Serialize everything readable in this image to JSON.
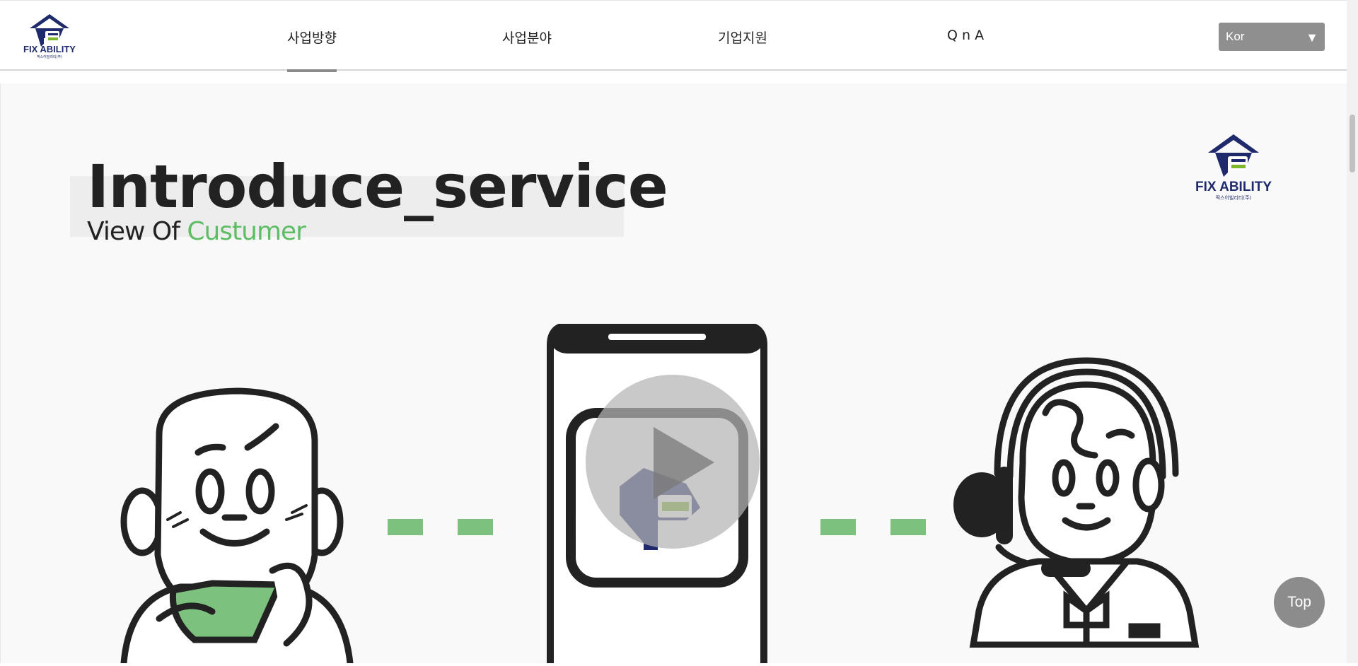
{
  "header": {
    "logo": {
      "text": "FIX ABILITY",
      "subtext": "픽스어빌리티(주)"
    },
    "nav": [
      {
        "label": "사업방향"
      },
      {
        "label": "사업분야"
      },
      {
        "label": "기업지원"
      },
      {
        "label": "Q n A"
      }
    ],
    "language": {
      "selected": "Kor"
    }
  },
  "hero": {
    "title": "Introduce_service",
    "subtitle_prefix": "View Of ",
    "subtitle_accent": "Custumer",
    "logo": {
      "text": "FIX ABILITY",
      "subtext": "픽스어빌리티(주)"
    }
  },
  "video": {
    "play_icon": "play-icon"
  },
  "top_button": {
    "label": "Top"
  },
  "colors": {
    "accent_green": "#5cbd63",
    "navy": "#1e2a6b",
    "logo_green": "#7cb72e",
    "dash": "#7cc17e"
  }
}
